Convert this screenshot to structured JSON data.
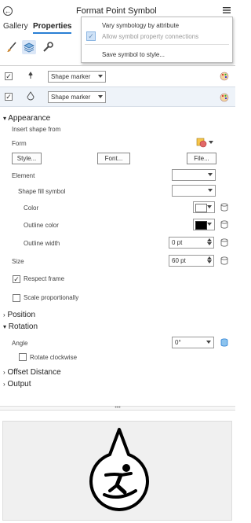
{
  "panel": {
    "title": "Format Point Symbol",
    "tabs": [
      {
        "label": "Gallery"
      },
      {
        "label": "Properties"
      }
    ]
  },
  "context_menu": {
    "items": [
      {
        "label": "Vary symbology by attribute",
        "enabled": true
      },
      {
        "label": "Allow symbol property connections",
        "enabled": false,
        "checked": true
      },
      {
        "label": "Save symbol to style..."
      }
    ]
  },
  "layers": [
    {
      "type": "Shape marker",
      "checked": true
    },
    {
      "type": "Shape marker",
      "checked": true
    }
  ],
  "appearance": {
    "heading": "Appearance",
    "insert_shape_label": "Insert shape from",
    "form_label": "Form",
    "style_button": "Style...",
    "font_button": "Font...",
    "file_button": "File...",
    "element_label": "Element",
    "element_value": "",
    "shape_fill_label": "Shape fill symbol",
    "shape_fill_value": "",
    "color_label": "Color",
    "color_value": "#ffffff",
    "outline_color_label": "Outline color",
    "outline_color_value": "#000000",
    "outline_width_label": "Outline width",
    "outline_width_value": "0 pt",
    "size_label": "Size",
    "size_value": "60 pt",
    "respect_frame_label": "Respect frame",
    "respect_frame_checked": true,
    "scale_prop_label": "Scale proportionally",
    "scale_prop_checked": false
  },
  "position": {
    "heading": "Position"
  },
  "rotation": {
    "heading": "Rotation",
    "angle_label": "Angle",
    "angle_value": "0°",
    "rotate_clockwise_label": "Rotate clockwise",
    "rotate_clockwise_checked": false
  },
  "offset": {
    "heading": "Offset Distance"
  },
  "output": {
    "heading": "Output"
  },
  "colors": {
    "accent": "#2a7fd4",
    "preview_bg": "#f0f0f0"
  }
}
